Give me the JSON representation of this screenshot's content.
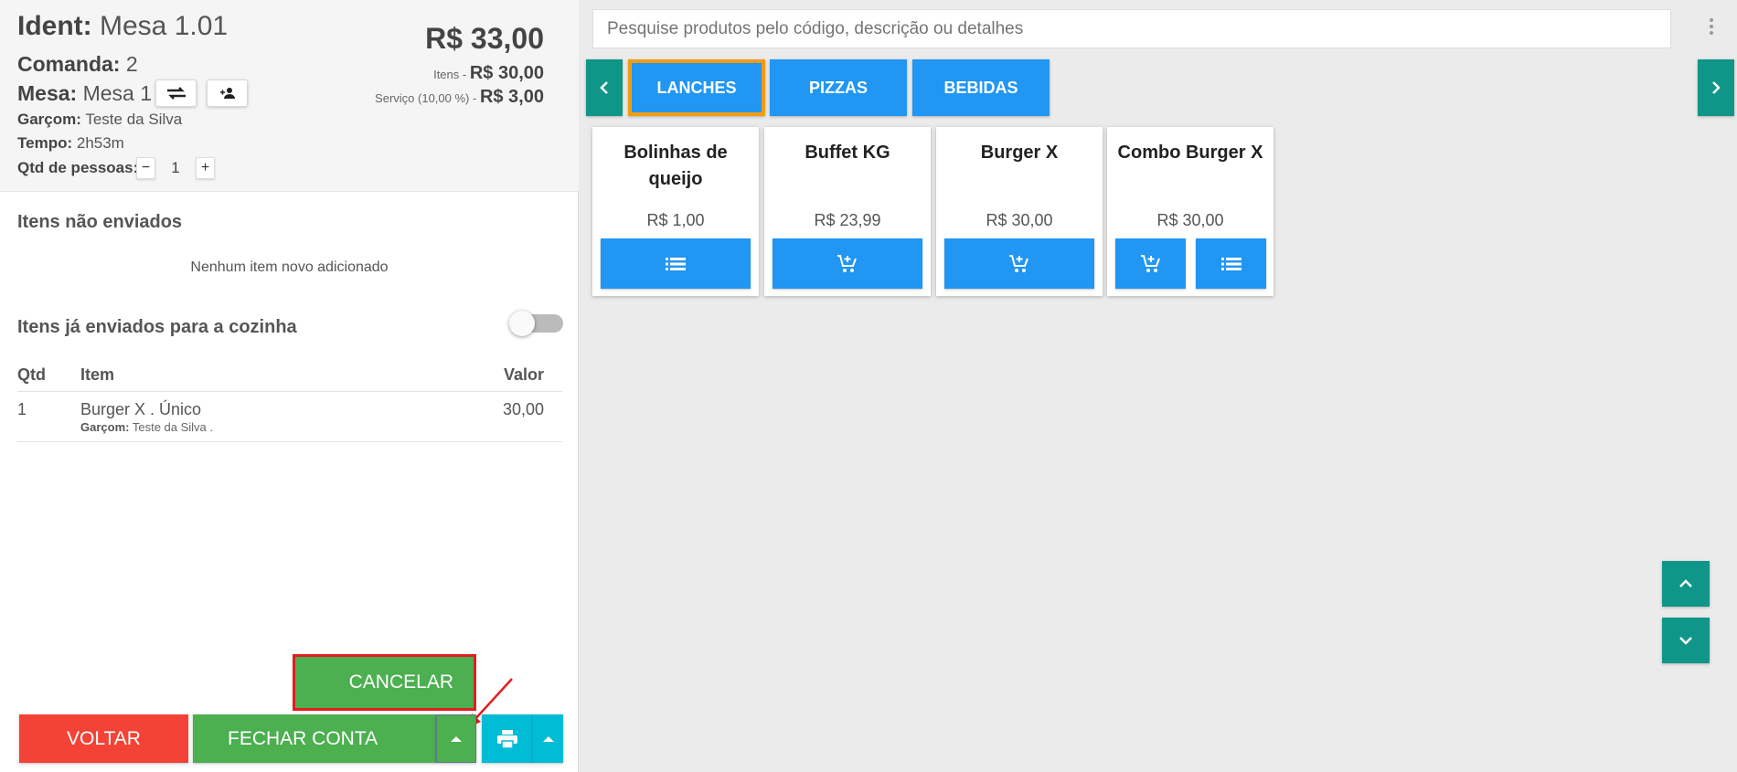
{
  "header": {
    "ident_label": "Ident:",
    "ident_value": "Mesa 1.01",
    "comanda_label": "Comanda:",
    "comanda_value": "2",
    "mesa_label": "Mesa:",
    "mesa_value": "Mesa 1",
    "garcom_label": "Garçom:",
    "garcom_value": "Teste da Silva",
    "tempo_label": "Tempo:",
    "tempo_value": "2h53m",
    "pessoas_label": "Qtd de pessoas:",
    "pessoas_value": "1",
    "minus": "−",
    "plus": "+",
    "total": "R$ 33,00",
    "itens_label": "Itens -",
    "itens_value": "R$ 30,00",
    "servico_label": "Serviço (10,00 %) -",
    "servico_value": "R$ 3,00"
  },
  "unsent": {
    "title": "Itens não enviados",
    "empty": "Nenhum item novo adicionado"
  },
  "sent": {
    "title": "Itens já enviados para a cozinha",
    "toggle_on": false,
    "columns": [
      "Qtd",
      "Item",
      "Valor"
    ],
    "rows": [
      {
        "qtd": "1",
        "item": "Burger X . Único",
        "garcom_label": "Garçom:",
        "garcom": "Teste da Silva .",
        "valor": "30,00"
      }
    ]
  },
  "footer": {
    "cancelar": "CANCELAR",
    "voltar": "VOLTAR",
    "fechar": "FECHAR CONTA"
  },
  "search": {
    "placeholder": "Pesquise produtos pelo código, descrição ou detalhes"
  },
  "categories": [
    {
      "label": "LANCHES",
      "active": true
    },
    {
      "label": "PIZZAS",
      "active": false
    },
    {
      "label": "BEBIDAS",
      "active": false
    }
  ],
  "products": [
    {
      "name": "Bolinhas de queijo",
      "price": "R$ 1,00",
      "buttons": [
        "list-icon"
      ]
    },
    {
      "name": "Buffet KG",
      "price": "R$ 23,99",
      "buttons": [
        "cart-add-icon"
      ]
    },
    {
      "name": "Burger X",
      "price": "R$ 30,00",
      "buttons": [
        "cart-add-icon"
      ]
    },
    {
      "name": "Combo Burger X",
      "price": "R$ 30,00",
      "buttons": [
        "cart-add-icon",
        "list-icon"
      ]
    }
  ],
  "colors": {
    "green": "#4caf50",
    "red": "#f44336",
    "blue": "#2196f3",
    "teal": "#0f9688",
    "cyan": "#00bcd4",
    "orange": "#f39c12"
  }
}
